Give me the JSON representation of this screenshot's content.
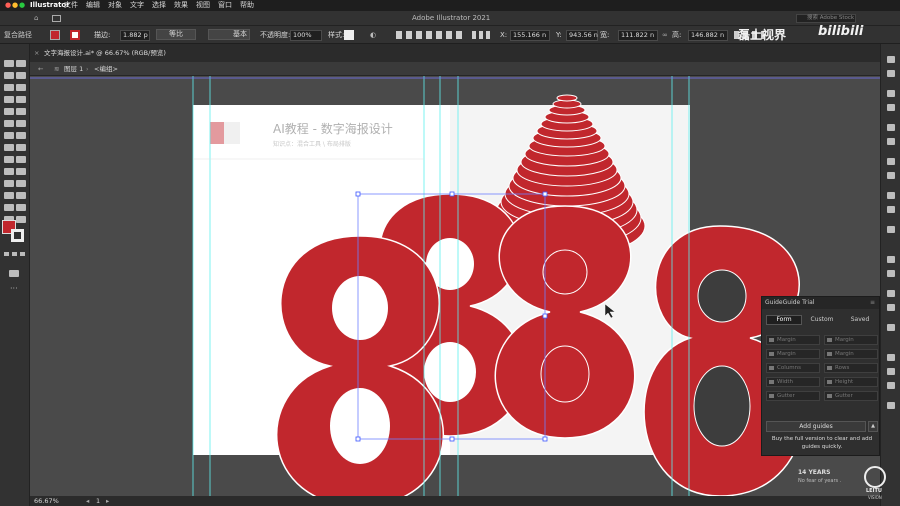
{
  "menubar": {
    "app": "Illustrator",
    "items": [
      "文件",
      "编辑",
      "对象",
      "文字",
      "选择",
      "效果",
      "视图",
      "窗口",
      "帮助"
    ]
  },
  "titlebar": {
    "title": "Adobe Illustrator 2021",
    "search_placeholder": "搜索 Adobe Stock",
    "left_label": "复合路径"
  },
  "controlbar": {
    "stroke_label": "描边:",
    "stroke_value": "1.882 p",
    "line1_label": "等比",
    "line2_label": "基本",
    "opacity_label": "不透明度:",
    "opacity_value": "100%",
    "style_label": "样式:",
    "x_label": "X:",
    "x_value": "155.166 n",
    "y_label": "Y:",
    "y_value": "943.56 n",
    "w_label": "宽:",
    "w_value": "111.822 n",
    "h_label": "高:",
    "h_value": "146.882 n"
  },
  "tab": {
    "label": "文字海报设计.ai* @ 66.67% (RGB/预览)",
    "close": "×"
  },
  "crumb": {
    "layer": "图层 1",
    "group": "<编组>"
  },
  "artboard": {
    "title": "AI教程 - 数字海报设计",
    "subtitle": "知识点：混合工具 \\ 布局排版",
    "years_big": "14 YEARS",
    "years_small": "No fear of years ."
  },
  "guideguide": {
    "title": "GuideGuide Trial",
    "tabs": [
      "Form",
      "Custom",
      "Saved"
    ],
    "fields_left": [
      "Margin",
      "Margin",
      "Columns",
      "Width",
      "Gutter"
    ],
    "fields_right": [
      "Margin",
      "Margin",
      "Rows",
      "Height",
      "Gutter"
    ],
    "add_button": "Add guides",
    "trial_note": "Buy the full version to clear and add guides quickly."
  },
  "status": {
    "zoom": "66.67%",
    "page": "1"
  },
  "watermark": {
    "brand_cn": "磊土视界",
    "brand_site": "bilibili",
    "logo_text": "LEITU",
    "logo_sub": "VISION"
  },
  "colors": {
    "accent_red": "#c1272d",
    "artboard": "#ffffff",
    "ui_dark": "#323232",
    "guide": "#5ef0ee"
  }
}
